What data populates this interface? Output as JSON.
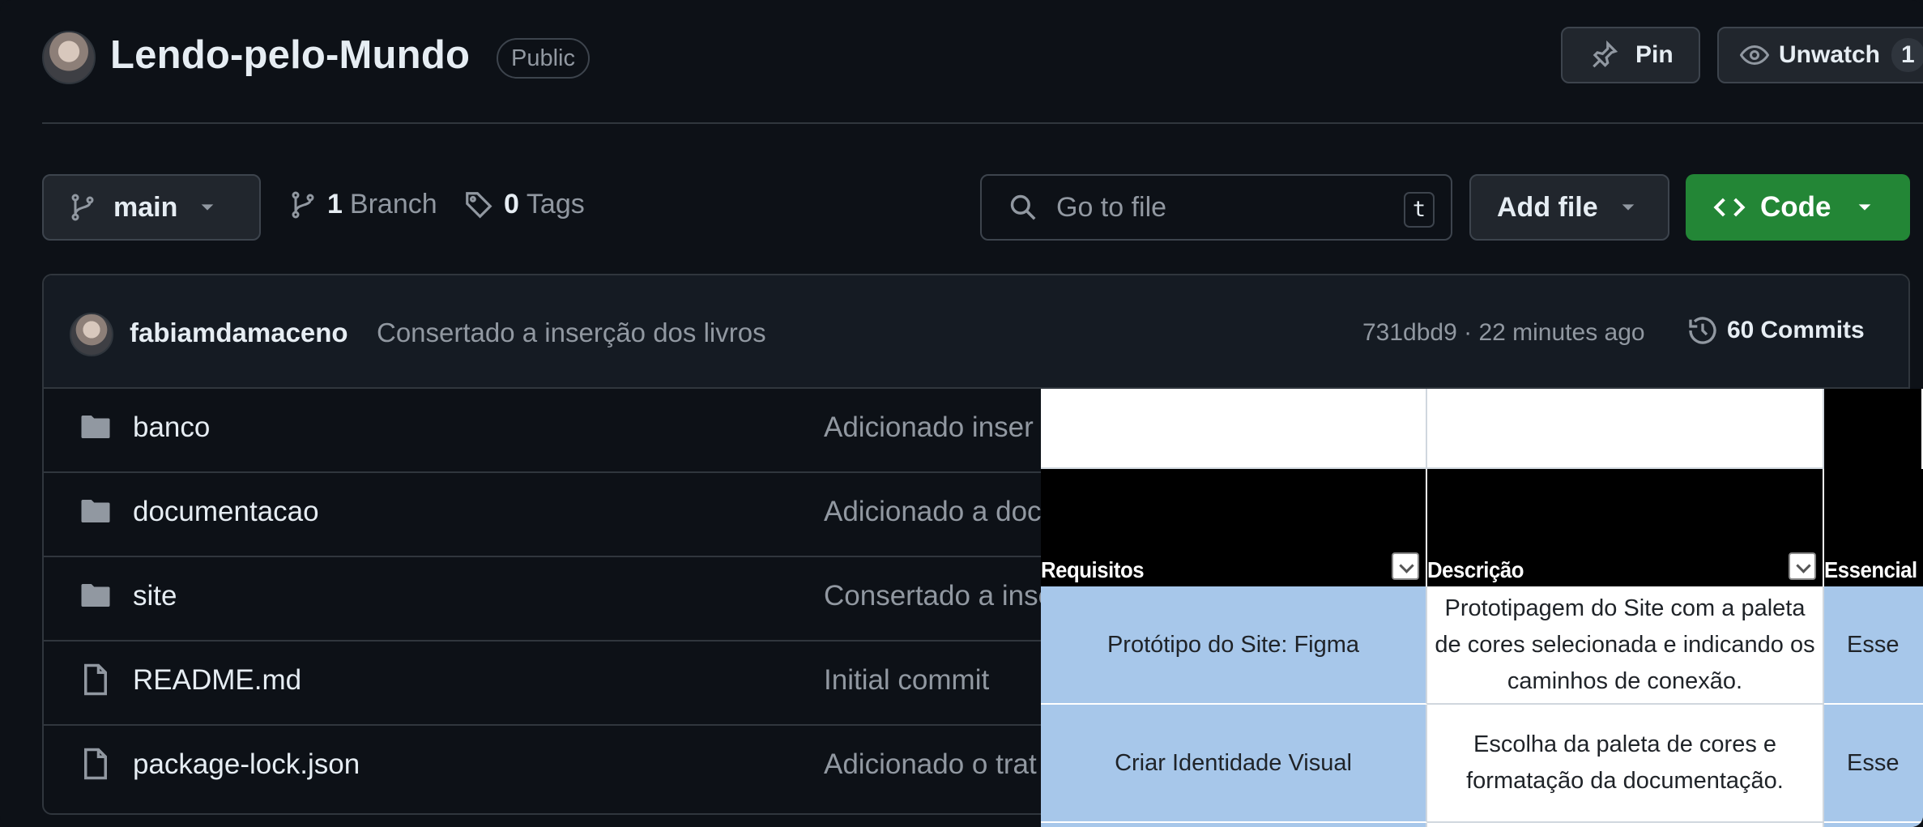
{
  "repo": {
    "name": "Lendo-pelo-Mundo",
    "visibility": "Public"
  },
  "header": {
    "pin_label": "Pin",
    "unwatch_label": "Unwatch",
    "watch_count": "1"
  },
  "toolbar": {
    "branch": "main",
    "branch_count": "1",
    "branch_label": "Branch",
    "tag_count": "0",
    "tag_label": "Tags",
    "search_placeholder": "Go to file",
    "search_shortcut": "t",
    "add_file_label": "Add file",
    "code_label": "Code"
  },
  "commit": {
    "author": "fabiamdamaceno",
    "message": "Consertado a inserção dos livros",
    "hash_time": "731dbd9 · 22 minutes ago",
    "commits_count": "60",
    "commits_label": "Commits"
  },
  "files": [
    {
      "name": "banco",
      "type": "folder",
      "message": "Adicionado inser"
    },
    {
      "name": "documentacao",
      "type": "folder",
      "message": "Adicionado a doc"
    },
    {
      "name": "site",
      "type": "folder",
      "message": "Consertado a inse"
    },
    {
      "name": "README.md",
      "type": "file",
      "message": "Initial commit"
    },
    {
      "name": "package-lock.json",
      "type": "file",
      "message": "Adicionado o trat"
    }
  ],
  "sheet": {
    "headers": [
      "Requisitos",
      "Descrição",
      "Essencial"
    ],
    "rows": [
      {
        "requisito": "Protótipo do Site: Figma",
        "descricao": [
          "Prototipagem do Site com a paleta",
          "de cores selecionada e indicando os",
          "caminhos de conexão."
        ],
        "essencial": "Esse"
      },
      {
        "requisito": "Criar Identidade Visual",
        "descricao": [
          "Escolha da paleta de cores e",
          "formatação da documentação."
        ],
        "essencial": "Esse"
      }
    ]
  },
  "colors": {
    "background": "#0d1117",
    "code_button": "#238636",
    "sheet_blue": "#a7c7ea"
  }
}
